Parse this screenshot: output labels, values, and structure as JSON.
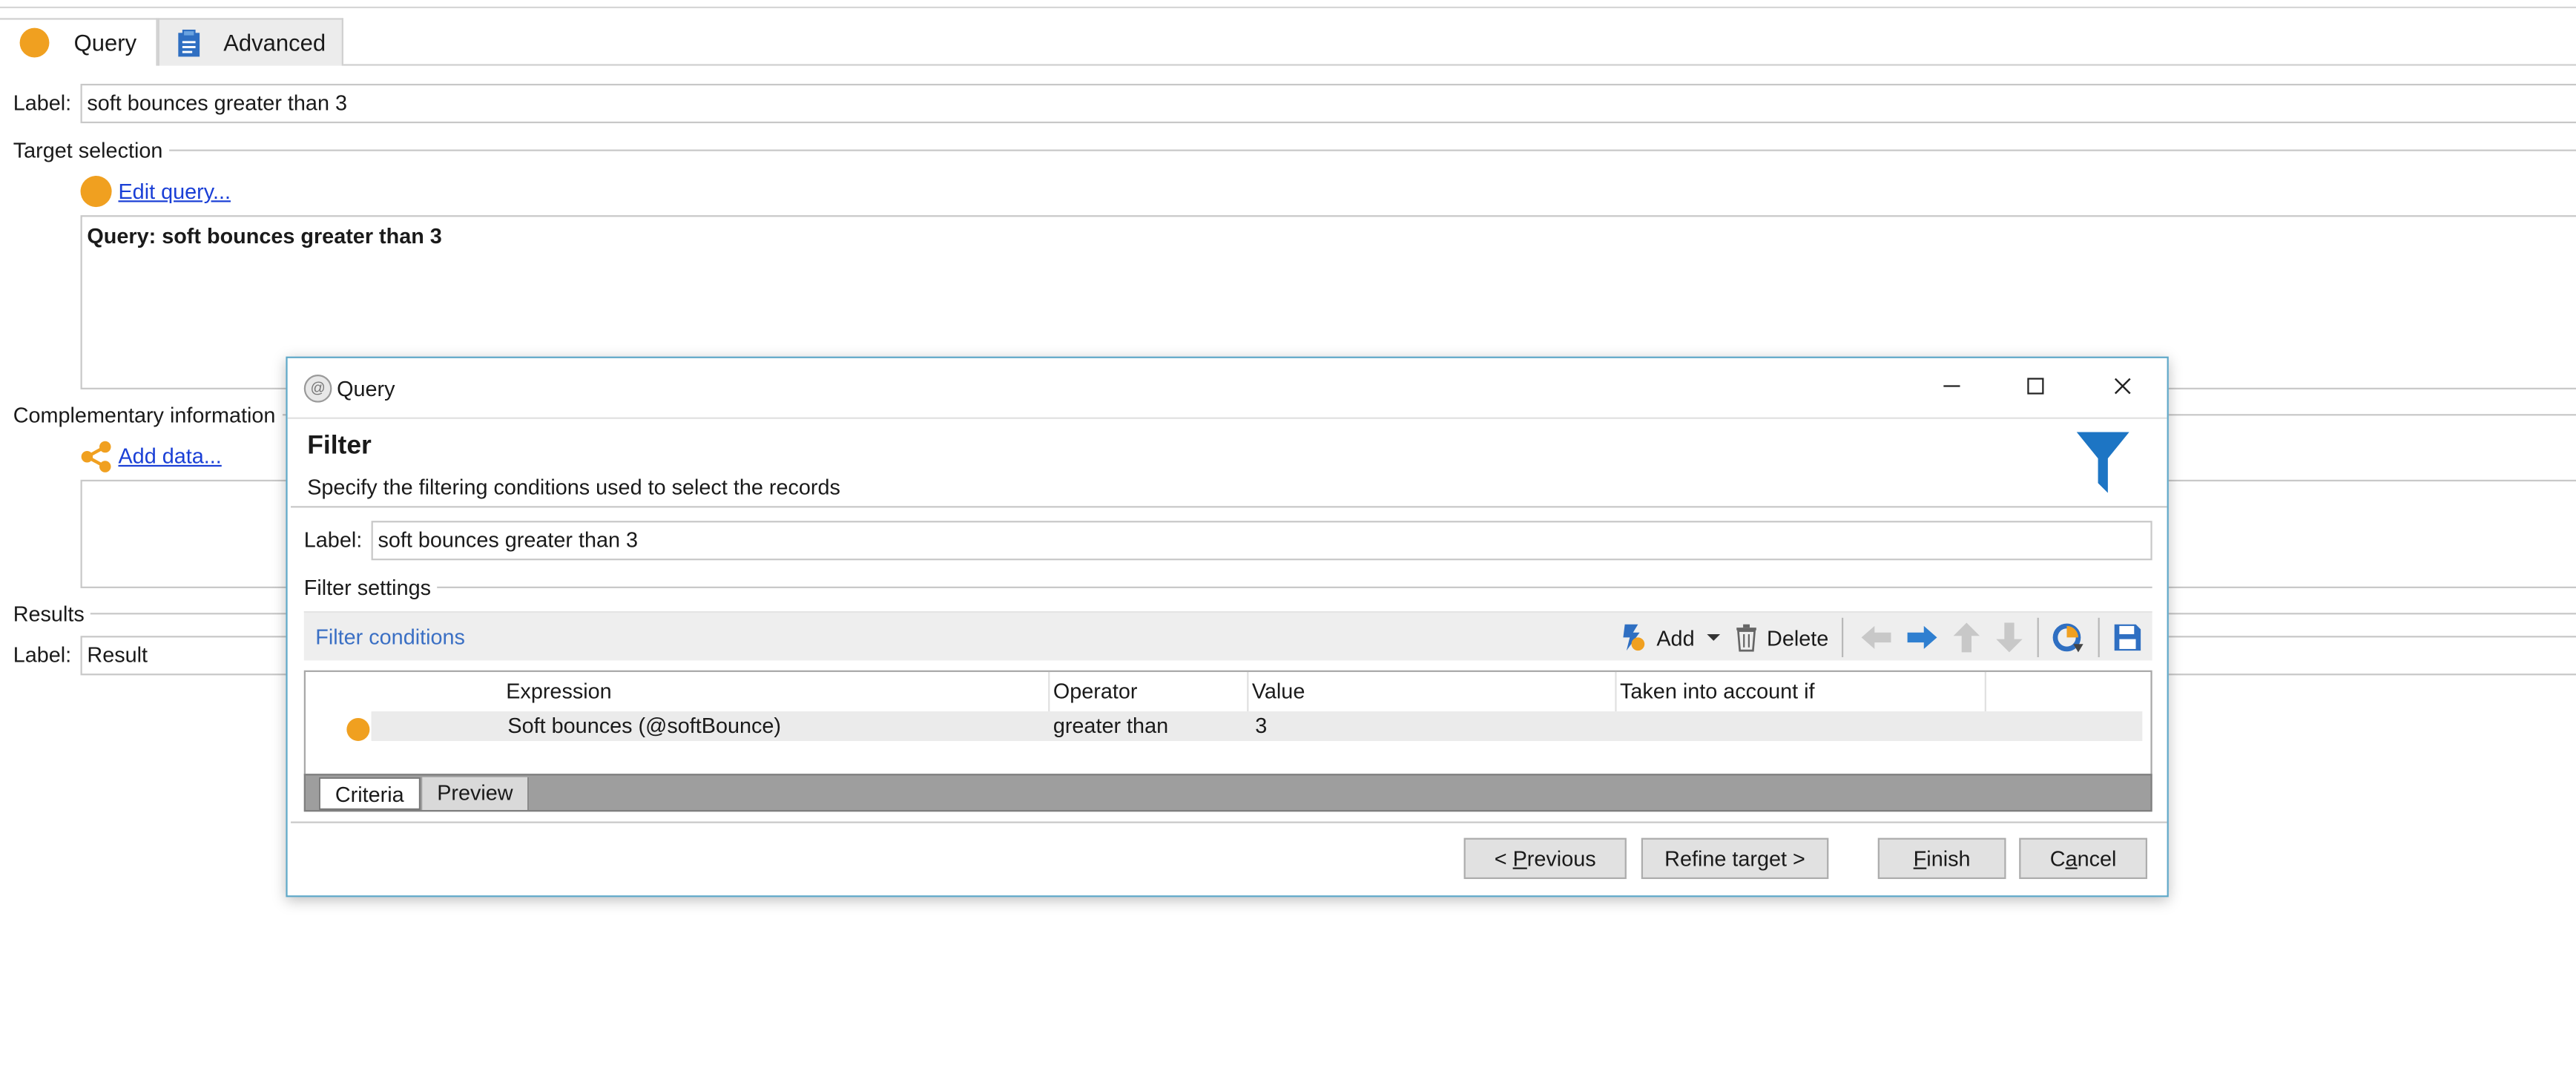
{
  "tabs": [
    {
      "label": "Query"
    },
    {
      "label": "Advanced"
    }
  ],
  "form": {
    "label_caption": "Label:",
    "label_value": "soft bounces greater than 3",
    "target_selection": "Target selection",
    "edit_query_link": "Edit query...",
    "query_summary": "Query: soft bounces greater than 3",
    "complementary_information": "Complementary information",
    "add_data_link": "Add data...",
    "results": "Results",
    "results_label_caption": "Label:",
    "results_label_value": "Result"
  },
  "dialog": {
    "title": "Query",
    "heading": "Filter",
    "subheading": "Specify the filtering conditions used to select the records",
    "label_caption": "Label:",
    "label_value": "soft bounces greater than 3",
    "filter_settings": "Filter settings",
    "toolbar": {
      "title": "Filter conditions",
      "add_label": "Add",
      "delete_label": "Delete"
    },
    "grid": {
      "columns": [
        "Expression",
        "Operator",
        "Value",
        "Taken into account if"
      ],
      "rows": [
        {
          "expression": "Soft bounces (@softBounce)",
          "operator": "greater than",
          "value": "3",
          "taken_into_account_if": ""
        }
      ]
    },
    "bottom_tabs": [
      "Criteria",
      "Preview"
    ],
    "buttons": {
      "previous_prefix": "< ",
      "previous_key": "P",
      "previous_rest": "revious",
      "refine_target": "Refine target >",
      "finish_key": "F",
      "finish_rest": "inish",
      "cancel_prefix": "C",
      "cancel_key": "a",
      "cancel_rest": "ncel"
    }
  },
  "colors": {
    "accent_orange": "#f0a020",
    "funnel_blue": "#1d75c4",
    "link_blue": "#1a3fd6",
    "dialog_border": "#5fa8c8"
  }
}
